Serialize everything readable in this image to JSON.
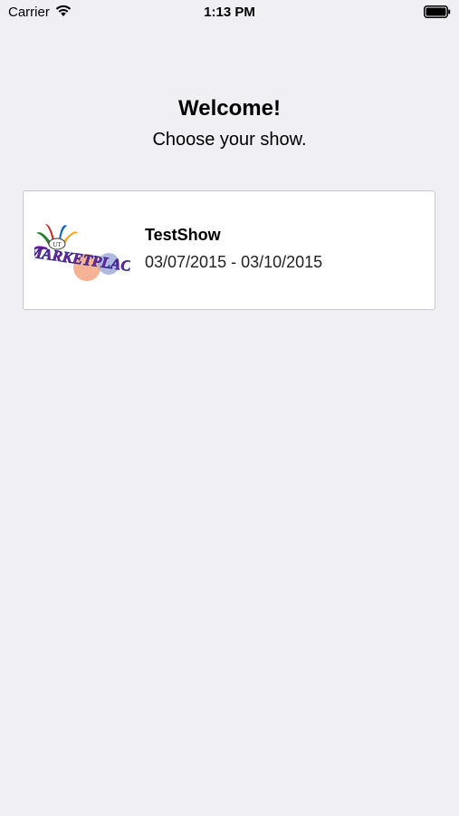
{
  "status_bar": {
    "carrier": "Carrier",
    "time": "1:13 PM"
  },
  "header": {
    "title": "Welcome!",
    "subtitle": "Choose your show."
  },
  "shows": [
    {
      "name": "TestShow",
      "dates": "03/07/2015 - 03/10/2015",
      "logo_text": "MARKETPLACE",
      "logo_badge": "UT"
    }
  ],
  "colors": {
    "background": "#efeff4",
    "card": "#ffffff",
    "card_border": "#c8c8cc"
  }
}
